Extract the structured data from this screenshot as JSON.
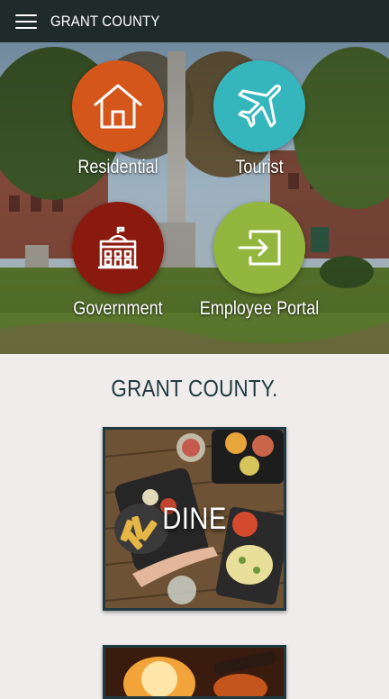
{
  "appbar": {
    "title": "GRANT COUNTY",
    "menu_icon": "hamburger-menu-icon"
  },
  "hero": {
    "tiles": [
      {
        "label": "Residential",
        "icon": "house-icon",
        "color": "#d5561b"
      },
      {
        "label": "Tourist",
        "icon": "airplane-icon",
        "color": "#35b6bd"
      },
      {
        "label": "Government",
        "icon": "government-building-icon",
        "color": "#8b1a0e"
      },
      {
        "label": "Employee Portal",
        "icon": "sign-in-icon",
        "color": "#93b63f"
      }
    ]
  },
  "main": {
    "title": "GRANT COUNTY.",
    "cards": [
      {
        "label": "DINE"
      },
      {
        "label": ""
      }
    ]
  },
  "colors": {
    "appbar": "#1f2b2a",
    "heading": "#1f3a40",
    "page_bg": "#efeceb"
  }
}
